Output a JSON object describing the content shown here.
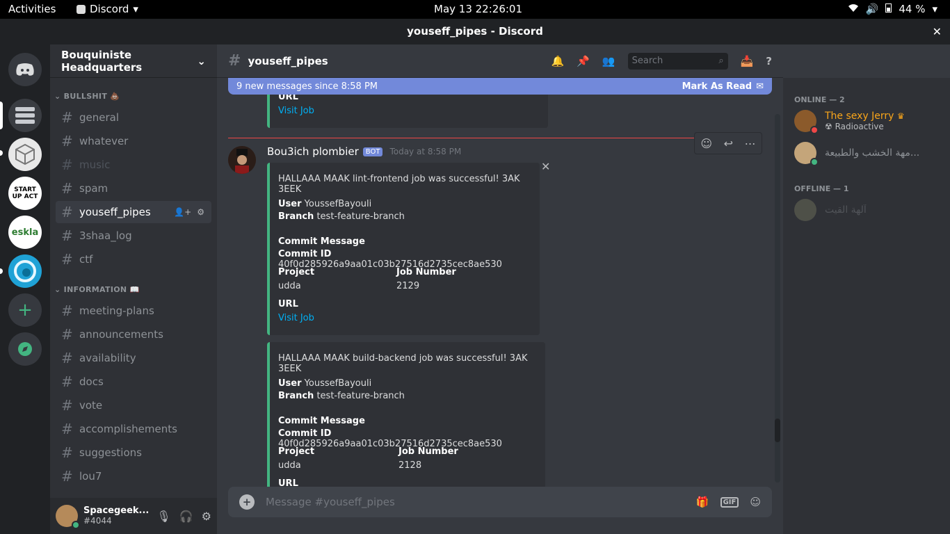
{
  "topbar": {
    "activities": "Activities",
    "app_name": "Discord",
    "clock": "May 13  22:26:01",
    "battery": "44 %"
  },
  "window": {
    "title": "youseff_pipes - Discord",
    "close": "✕"
  },
  "server": {
    "name": "Bouquiniste Headquarters"
  },
  "categories": [
    {
      "label": "BULLSHIT 💩"
    },
    {
      "label": "INFORMATION 📖"
    }
  ],
  "channels": [
    {
      "name": "general"
    },
    {
      "name": "whatever"
    },
    {
      "name": "music"
    },
    {
      "name": "spam"
    },
    {
      "name": "youseff_pipes"
    },
    {
      "name": "3shaa_log"
    },
    {
      "name": "ctf"
    },
    {
      "name": "meeting-plans"
    },
    {
      "name": "announcements"
    },
    {
      "name": "availability"
    },
    {
      "name": "docs"
    },
    {
      "name": "vote"
    },
    {
      "name": "accomplishements"
    },
    {
      "name": "suggestions"
    },
    {
      "name": "lou7"
    }
  ],
  "user": {
    "name": "Spacegeek...",
    "tag": "#4044"
  },
  "guild_labels": {
    "startup": "START UP ACT",
    "eskla": "eskla"
  },
  "header": {
    "channel": "youseff_pipes",
    "search_placeholder": "Search"
  },
  "newbar": {
    "text": "9 new messages since 8:58 PM",
    "mark": "Mark As Read"
  },
  "top_embed": {
    "url_label": "URL",
    "link": "Visit Job"
  },
  "message": {
    "author": "Bou3ich plombier",
    "bot": "BOT",
    "time": "Today at 8:58 PM"
  },
  "embeds": [
    {
      "title": "HALLAAA MAAK lint-frontend job was successful! 3AK 3EEK",
      "user_label": "User",
      "user": "YoussefBayouli",
      "branch_label": "Branch",
      "branch": "test-feature-branch",
      "commit_msg_label": "Commit Message",
      "commit_id_label": "Commit ID",
      "commit_id": "40f0d285926a9aa01c03b27516d2735cec8ae530",
      "project_label": "Project",
      "project": "udda",
      "job_label": "Job Number",
      "job": "2129",
      "url_label": "URL",
      "link": "Visit Job"
    },
    {
      "title": "HALLAAA MAAK build-backend job was successful! 3AK 3EEK",
      "user_label": "User",
      "user": "YoussefBayouli",
      "branch_label": "Branch",
      "branch": "test-feature-branch",
      "commit_msg_label": "Commit Message",
      "commit_id_label": "Commit ID",
      "commit_id": "40f0d285926a9aa01c03b27516d2735cec8ae530",
      "project_label": "Project",
      "project": "udda",
      "job_label": "Job Number",
      "job": "2128",
      "url_label": "URL"
    }
  ],
  "composer": {
    "placeholder": "Message #youseff_pipes",
    "gif": "GIF"
  },
  "members": {
    "online_label": "ONLINE — 2",
    "offline_label": "OFFLINE — 1",
    "online": [
      {
        "name": "The sexy Jerry",
        "status": "Radioactive",
        "color": "#faa61a"
      },
      {
        "name": "مهة الخشب والطبيعة..."
      }
    ],
    "offline": [
      {
        "name": "آلهة القيت"
      }
    ]
  }
}
